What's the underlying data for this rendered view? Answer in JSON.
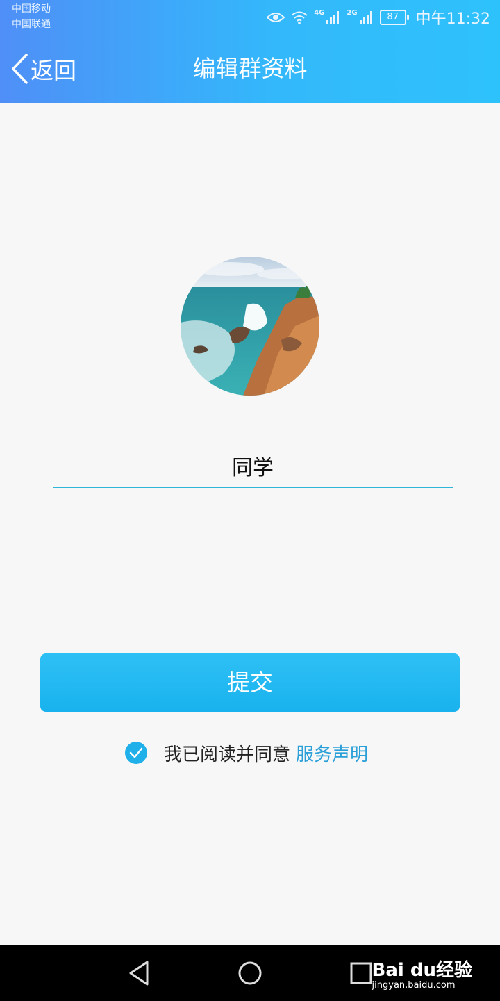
{
  "status_bar": {
    "carrier_1": "中国移动",
    "carrier_2": "中国联通",
    "net_1": "4G",
    "net_2": "2G",
    "battery": "87",
    "time": "中午11:32"
  },
  "header": {
    "back_label": "返回",
    "title": "编辑群资料"
  },
  "form": {
    "group_name": "同学",
    "submit_label": "提交",
    "agree_text": "我已阅读并同意",
    "agree_link": "服务声明",
    "agreed": true
  },
  "watermark": {
    "logo": "Bai du经验",
    "url": "jingyan.baidu.com"
  },
  "colors": {
    "header_start": "#4f8ff7",
    "header_end": "#2ec2fc",
    "accent": "#1fb0ea",
    "link": "#2a9fd8"
  }
}
